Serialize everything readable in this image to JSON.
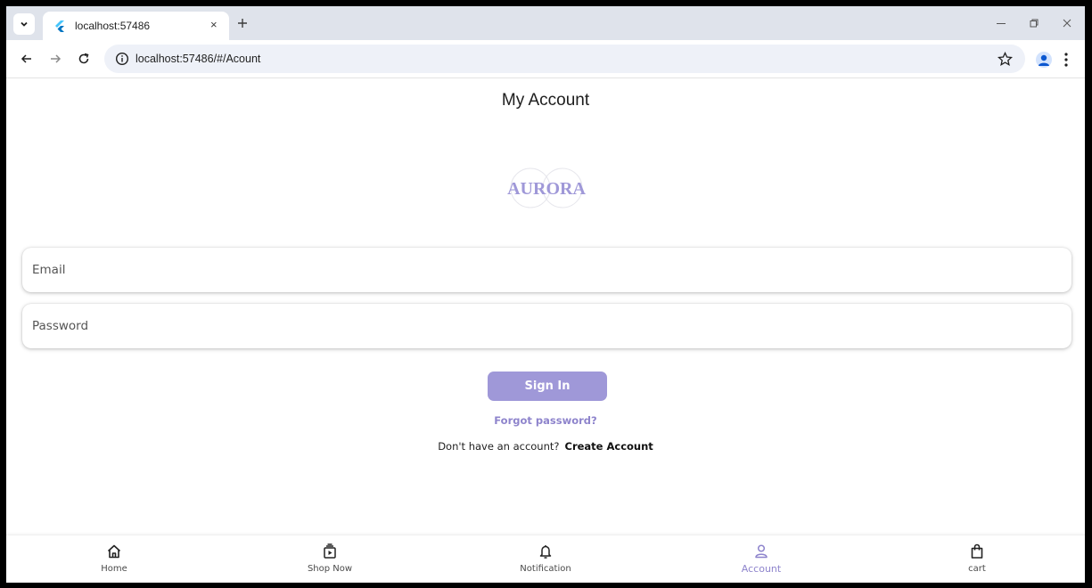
{
  "browser": {
    "tab_title": "localhost:57486",
    "url": "localhost:57486/#/Acount",
    "new_tab_symbol": "+",
    "tab_close_symbol": "×"
  },
  "page": {
    "title": "My Account",
    "logo_text": "AURORA",
    "email_placeholder": "Email",
    "password_placeholder": "Password",
    "sign_in_label": "Sign In",
    "forgot_password": "Forgot password?",
    "no_account_text": "Don't have an account?",
    "create_account": "Create Account"
  },
  "bottom_nav": {
    "items": [
      {
        "label": "Home",
        "icon": "home-icon"
      },
      {
        "label": "Shop Now",
        "icon": "shop-now-icon"
      },
      {
        "label": "Notification",
        "icon": "bell-icon"
      },
      {
        "label": "Account",
        "icon": "person-icon",
        "active": true
      },
      {
        "label": "cart",
        "icon": "shopping-bag-icon"
      }
    ]
  },
  "colors": {
    "accent": "#9f98d8",
    "accent_text": "#8e84cc",
    "tabstrip": "#dfe3eb",
    "omnibox": "#eef1f8"
  }
}
